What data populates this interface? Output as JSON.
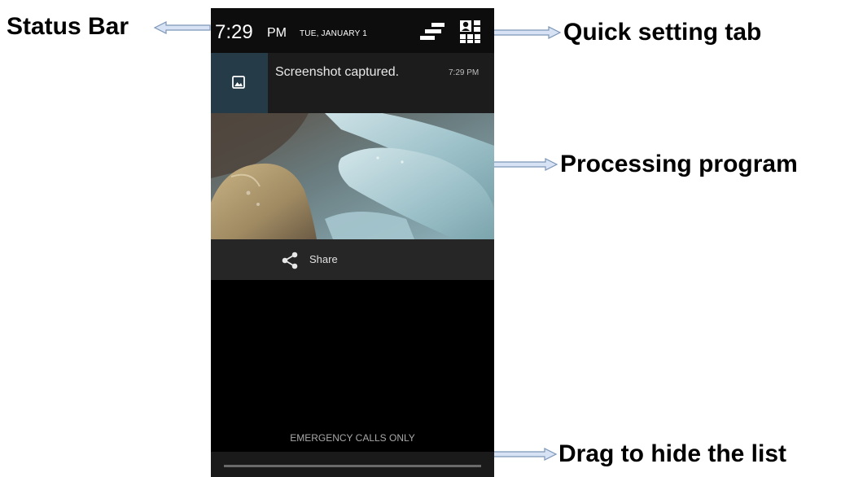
{
  "callouts": {
    "status_bar": "Status Bar",
    "quick_setting": "Quick setting tab",
    "processing": "Processing program",
    "drag": "Drag to hide the list"
  },
  "status_bar": {
    "time": "7:29",
    "ampm": "PM",
    "date": "TUE, JANUARY 1",
    "toggle_icon": "notification-toggle-icon",
    "quick_settings_icon": "quick-settings-icon"
  },
  "notification": {
    "icon": "image-icon",
    "title": "Screenshot captured.",
    "time": "7:29 PM",
    "preview": "screenshot-preview-image",
    "share_icon": "share-icon",
    "share_label": "Share"
  },
  "footer": {
    "emergency": "EMERGENCY CALLS ONLY"
  },
  "colors": {
    "screen_bg": "#000000",
    "statusbar_bg": "#0d0d0d",
    "notif_bg": "#1c1c1c",
    "icon_box": "#263b48",
    "share_bar": "#262626"
  }
}
